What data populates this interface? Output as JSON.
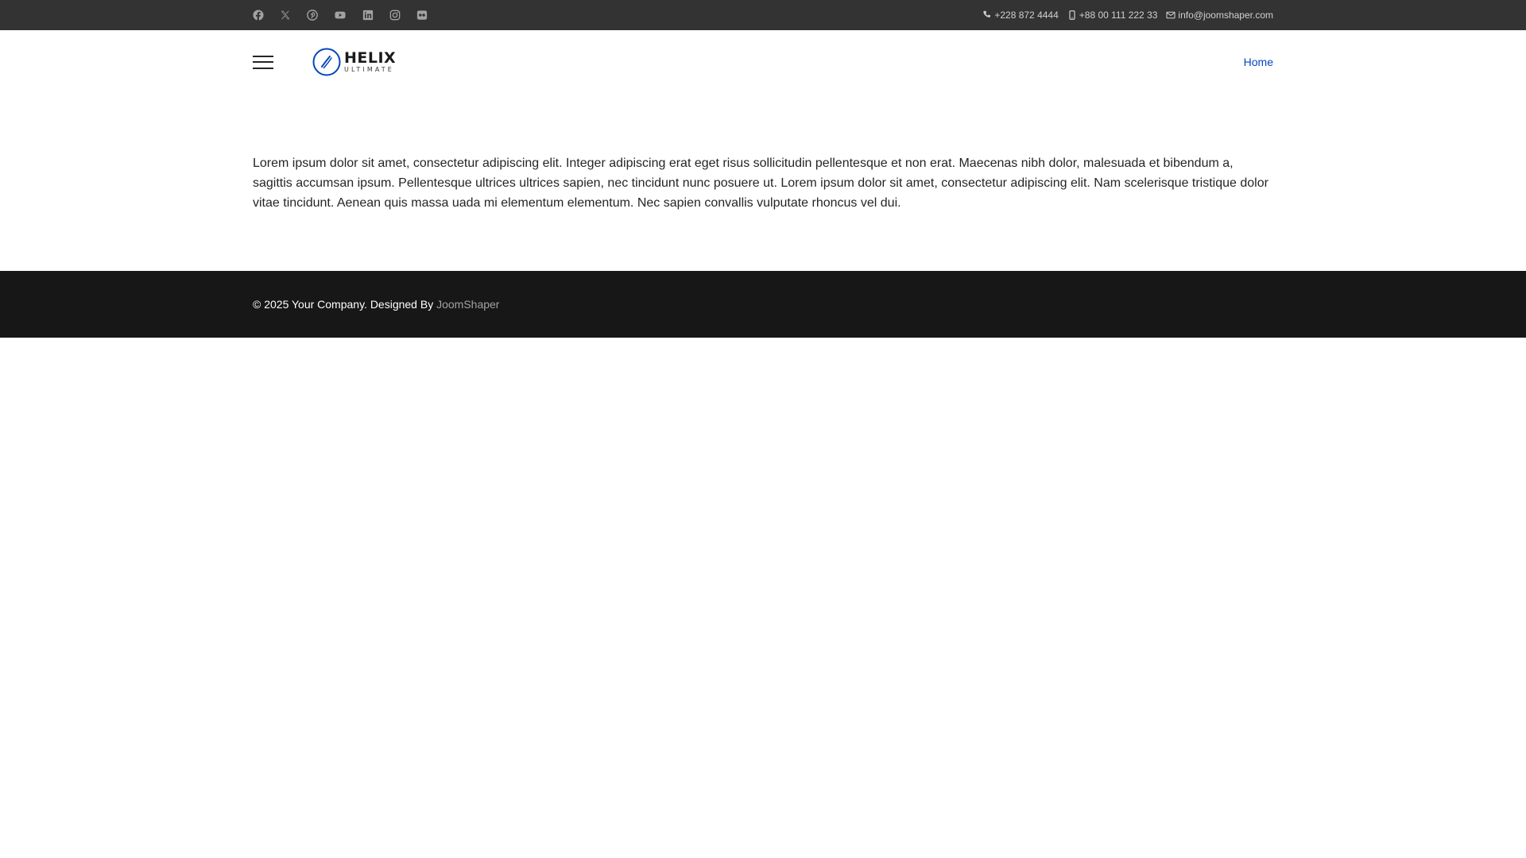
{
  "topbar": {
    "social_icons": [
      {
        "name": "facebook-icon",
        "color": "#a2a2a2"
      },
      {
        "name": "x-twitter-icon",
        "color": "#a2a2a2"
      },
      {
        "name": "pinterest-icon",
        "color": "#a2a2a2"
      },
      {
        "name": "youtube-icon",
        "color": "#a2a2a2"
      },
      {
        "name": "linkedin-icon",
        "color": "#a2a2a2"
      },
      {
        "name": "instagram-icon",
        "color": "#a2a2a2"
      },
      {
        "name": "flickr-icon",
        "color": "#a2a2a2"
      }
    ],
    "phone": "+228 872 4444",
    "mobile": "+88 00 111 222 33",
    "email": "info@joomshaper.com"
  },
  "header": {
    "logo": {
      "name": "HELIX",
      "sub": "ULTIMATE",
      "accent": "#0345bf"
    },
    "nav": {
      "home_label": "Home"
    }
  },
  "main": {
    "paragraph": "Lorem ipsum dolor sit amet, consectetur adipiscing elit. Integer adipiscing erat eget risus sollicitudin pellentesque et non erat. Maecenas nibh dolor, malesuada et bibendum a, sagittis accumsan ipsum. Pellentesque ultrices ultrices sapien, nec tincidunt nunc posuere ut. Lorem ipsum dolor sit amet, consectetur adipiscing elit. Nam scelerisque tristique dolor vitae tincidunt. Aenean quis massa uada mi elementum elementum. Nec sapien convallis vulputate rhoncus vel dui."
  },
  "footer": {
    "copyright": "© 2025 Your Company. Designed By ",
    "designer_link": "JoomShaper"
  },
  "colors": {
    "topbar_bg": "#333333",
    "footer_bg": "#171717",
    "link": "#0345bf"
  }
}
